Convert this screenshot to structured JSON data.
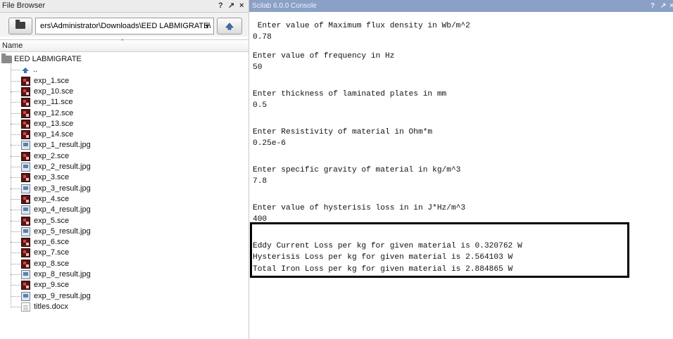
{
  "file_browser": {
    "title": "File Browser",
    "controls": [
      "?",
      "↗",
      "×"
    ],
    "path": "ers\\Administrator\\Downloads\\EED LABMIGRATE\\",
    "column_header": "Name",
    "root_folder": "EED LABMIGRATE",
    "parent_item": "..",
    "files": [
      {
        "name": "exp_1.sce",
        "type": "sce"
      },
      {
        "name": "exp_10.sce",
        "type": "sce"
      },
      {
        "name": "exp_11.sce",
        "type": "sce"
      },
      {
        "name": "exp_12.sce",
        "type": "sce"
      },
      {
        "name": "exp_13.sce",
        "type": "sce"
      },
      {
        "name": "exp_14.sce",
        "type": "sce"
      },
      {
        "name": "exp_1_result.jpg",
        "type": "jpg"
      },
      {
        "name": "exp_2.sce",
        "type": "sce"
      },
      {
        "name": "exp_2_result.jpg",
        "type": "jpg"
      },
      {
        "name": "exp_3.sce",
        "type": "sce"
      },
      {
        "name": "exp_3_result.jpg",
        "type": "jpg"
      },
      {
        "name": "exp_4.sce",
        "type": "sce"
      },
      {
        "name": "exp_4_result.jpg",
        "type": "jpg"
      },
      {
        "name": "exp_5.sce",
        "type": "sce"
      },
      {
        "name": "exp_5_result.jpg",
        "type": "jpg"
      },
      {
        "name": "exp_6.sce",
        "type": "sce"
      },
      {
        "name": "exp_7.sce",
        "type": "sce"
      },
      {
        "name": "exp_8.sce",
        "type": "sce"
      },
      {
        "name": "exp_8_result.jpg",
        "type": "jpg"
      },
      {
        "name": "exp_9.sce",
        "type": "sce"
      },
      {
        "name": "exp_9_result.jpg",
        "type": "jpg"
      },
      {
        "name": "titles.docx",
        "type": "doc"
      }
    ]
  },
  "console": {
    "title": "Scilab 6.0.0 Console",
    "controls": [
      "?",
      "↗",
      "×"
    ],
    "lines": [
      " Enter value of Maximum flux density in Wb/m^2",
      "0.78",
      "",
      "Enter value of frequency in Hz",
      "50",
      "",
      "",
      "Enter thickness of laminated plates in mm",
      "0.5",
      "",
      "",
      "Enter Resistivity of material in Ohm*m",
      "0.25e-6",
      "",
      "",
      "Enter specific gravity of material in kg/m^3",
      "7.8",
      "",
      "",
      "Enter value of hysterisis loss in in J*Hz/m^3",
      "400",
      "",
      "",
      "Eddy Current Loss per kg for given material is 0.320762 W",
      "Hysterisis Loss per kg for given material is 2.564103 W",
      "Total Iron Loss per kg for given material is 2.884865 W"
    ]
  }
}
